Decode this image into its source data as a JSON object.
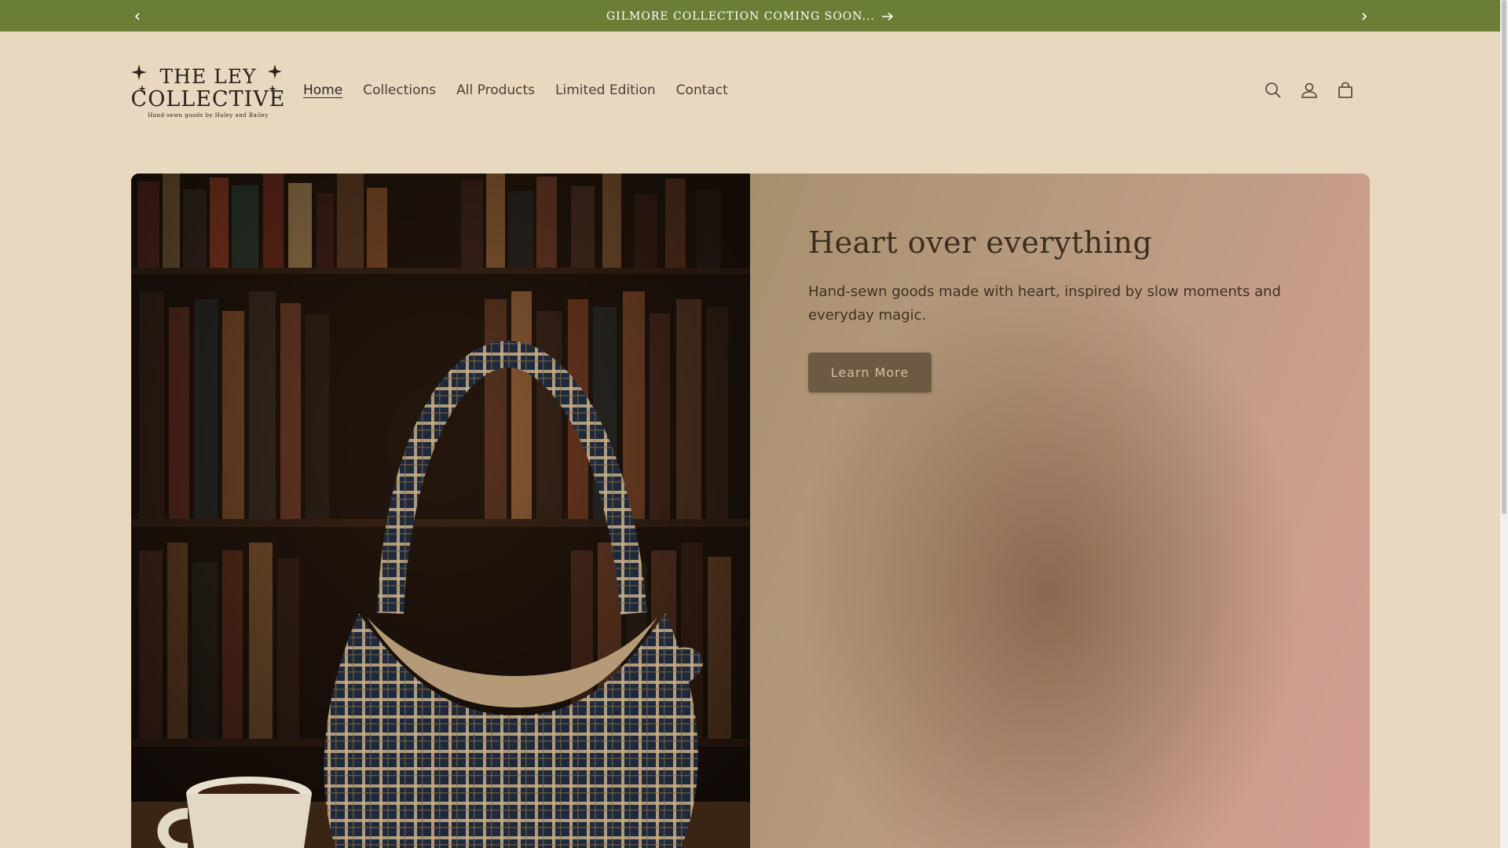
{
  "announcement": {
    "text": "GILMORE COLLECTION COMING SOON...",
    "background_color": "#6a7e36",
    "prev_icon": "chevron-left-icon",
    "next_icon": "chevron-right-icon",
    "arrow_icon": "arrow-right-icon"
  },
  "brand": {
    "name_line1": "THE LEY",
    "name_line2": "COLLECTIVE",
    "tagline": "Hand-sewn goods by Haley and Bailey"
  },
  "nav": {
    "items": [
      {
        "label": "Home",
        "active": true
      },
      {
        "label": "Collections",
        "active": false
      },
      {
        "label": "All Products",
        "active": false
      },
      {
        "label": "Limited Edition",
        "active": false
      },
      {
        "label": "Contact",
        "active": false
      }
    ]
  },
  "header_icons": [
    "search-icon",
    "account-icon",
    "cart-icon"
  ],
  "hero": {
    "title": "Heart over everything",
    "description": "Hand-sewn goods made with heart, inspired by slow moments and everyday magic.",
    "button_label": "Learn More",
    "image_subject": "plaid-tote-bag-with-coffee-cup"
  }
}
